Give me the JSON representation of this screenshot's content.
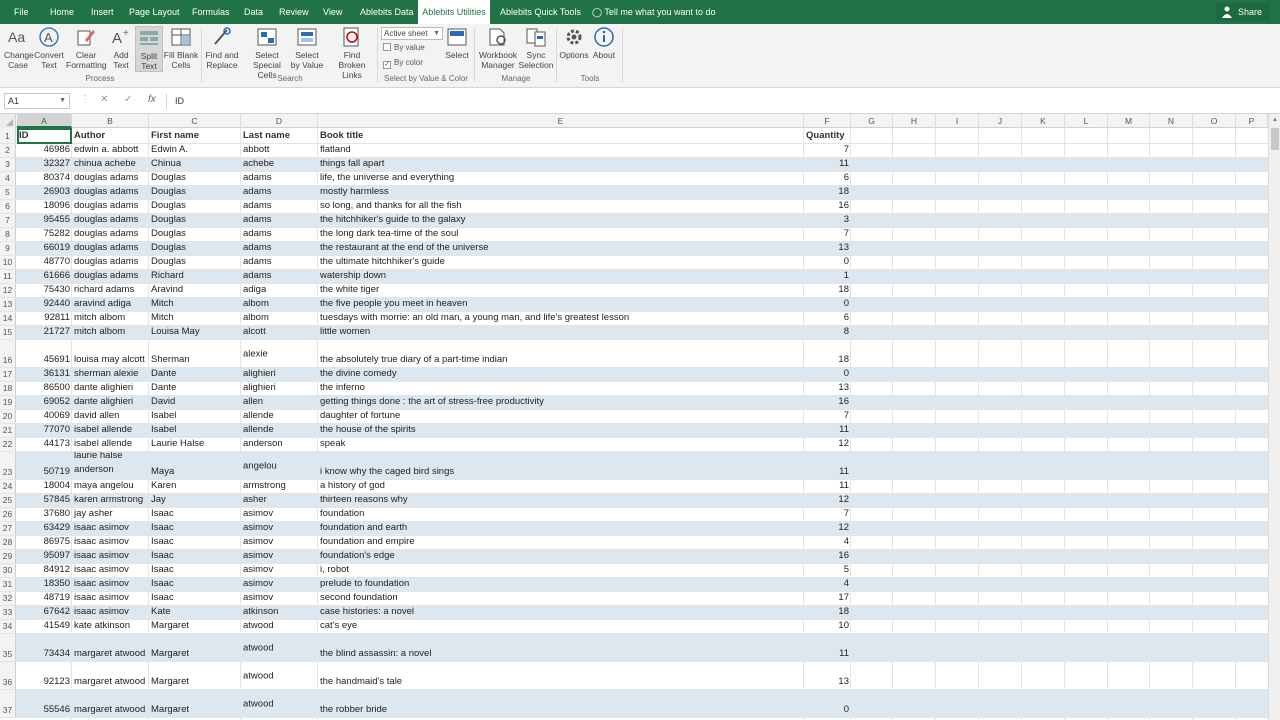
{
  "ribbon_tabs": [
    {
      "label": "File"
    },
    {
      "label": "Home"
    },
    {
      "label": "Insert"
    },
    {
      "label": "Page Layout"
    },
    {
      "label": "Formulas"
    },
    {
      "label": "Data"
    },
    {
      "label": "Review"
    },
    {
      "label": "View"
    },
    {
      "label": "Ablebits Data"
    },
    {
      "label": "Ablebits Utilities"
    },
    {
      "label": "Ablebits Quick Tools"
    }
  ],
  "active_tab": "Ablebits Utilities",
  "tell_me": "Tell me what you want to do",
  "share": "Share",
  "ribbon": {
    "buttons": [
      {
        "l1": "Change",
        "l2": "Case",
        "icon": "change-case-icon"
      },
      {
        "l1": "Convert",
        "l2": "Text",
        "icon": "convert-text-icon"
      },
      {
        "l1": "Clear",
        "l2": "Formatting",
        "icon": "clear-formatting-icon"
      },
      {
        "l1": "Add",
        "l2": "Text",
        "icon": "add-text-icon"
      },
      {
        "l1": "Split",
        "l2": "Text",
        "icon": "split-text-icon"
      },
      {
        "l1": "Fill Blank",
        "l2": "Cells",
        "icon": "fill-blank-icon"
      },
      {
        "l1": "Find and",
        "l2": "Replace",
        "icon": "find-replace-icon"
      },
      {
        "l1": "Select",
        "l2": "Special Cells",
        "icon": "select-special-icon"
      },
      {
        "l1": "Select",
        "l2": "by Value",
        "icon": "select-by-value-icon"
      },
      {
        "l1": "Find Broken",
        "l2": "Links",
        "icon": "broken-links-icon"
      },
      {
        "l1": "Select",
        "l2": "",
        "icon": "select-icon"
      },
      {
        "l1": "Workbook",
        "l2": "Manager",
        "icon": "workbook-manager-icon"
      },
      {
        "l1": "Sync",
        "l2": "Selection",
        "icon": "sync-selection-icon"
      },
      {
        "l1": "Options",
        "l2": "",
        "icon": "gear-icon"
      },
      {
        "l1": "About",
        "l2": "",
        "icon": "info-icon"
      }
    ],
    "groups": {
      "process": "Process",
      "search": "Search",
      "select": "Select by Value & Color",
      "manage": "Manage",
      "tools": "Tools"
    },
    "scope_dropdown": "Active sheet",
    "by_value": "By value",
    "by_color": "By color"
  },
  "formula_bar": {
    "name_box": "A1",
    "cancel": "✕",
    "enter": "✓",
    "fx": "fx",
    "value": "ID"
  },
  "columns": [
    "A",
    "B",
    "C",
    "D",
    "E",
    "F",
    "G",
    "H",
    "I",
    "J",
    "K",
    "L",
    "M",
    "N",
    "O",
    "P"
  ],
  "headers": [
    "ID",
    "Author",
    "First name",
    "Last name",
    "Book title",
    "Quantity"
  ],
  "rows": [
    {
      "n": "2",
      "id": "46986",
      "author": "edwin a. abbott",
      "first": "Edwin A.",
      "last": "abbott",
      "title": "flatland",
      "qty": "7"
    },
    {
      "n": "3",
      "id": "32327",
      "author": "chinua achebe",
      "first": "Chinua",
      "last": "achebe",
      "title": "things fall apart",
      "qty": "11"
    },
    {
      "n": "4",
      "id": "80374",
      "author": "douglas adams",
      "first": "Douglas",
      "last": "adams",
      "title": "life, the universe and everything",
      "qty": "6"
    },
    {
      "n": "5",
      "id": "26903",
      "author": "douglas adams",
      "first": "Douglas",
      "last": "adams",
      "title": "mostly harmless",
      "qty": "18"
    },
    {
      "n": "6",
      "id": "18096",
      "author": "douglas adams",
      "first": "Douglas",
      "last": "adams",
      "title": "so long, and thanks for all the fish",
      "qty": "16"
    },
    {
      "n": "7",
      "id": "95455",
      "author": "douglas adams",
      "first": "Douglas",
      "last": "adams",
      "title": "the hitchhiker's guide to the galaxy",
      "qty": "3"
    },
    {
      "n": "8",
      "id": "75282",
      "author": "douglas adams",
      "first": "Douglas",
      "last": "adams",
      "title": "the long dark tea-time of the soul",
      "qty": "7"
    },
    {
      "n": "9",
      "id": "66019",
      "author": "douglas adams",
      "first": "Douglas",
      "last": "adams",
      "title": "the restaurant at the end of the universe",
      "qty": "13"
    },
    {
      "n": "10",
      "id": "48770",
      "author": "douglas adams",
      "first": "Douglas",
      "last": "adams",
      "title": "the ultimate hitchhiker's guide",
      "qty": "0"
    },
    {
      "n": "11",
      "id": "61666",
      "author": "douglas adams",
      "first": "Richard",
      "last": "adams",
      "title": "watership down",
      "qty": "1"
    },
    {
      "n": "12",
      "id": "75430",
      "author": "richard adams",
      "first": "Aravind",
      "last": "adiga",
      "title": "the white tiger",
      "qty": "18"
    },
    {
      "n": "13",
      "id": "92440",
      "author": "aravind adiga",
      "first": "Mitch",
      "last": "albom",
      "title": "the five people you meet in heaven",
      "qty": "0"
    },
    {
      "n": "14",
      "id": "92811",
      "author": "mitch albom",
      "first": "Mitch",
      "last": "albom",
      "title": "tuesdays with morrie: an old man, a young man, and life's greatest lesson",
      "qty": "6"
    },
    {
      "n": "15",
      "id": "21727",
      "author": "mitch albom",
      "first": "Louisa May",
      "last": "alcott",
      "title": "little women",
      "qty": "8"
    },
    {
      "n": "16",
      "id": "45691",
      "author": "louisa may alcott",
      "first": "Sherman",
      "last": "alexie",
      "title": "the absolutely true diary of a part-time indian",
      "qty": "18",
      "tall": true
    },
    {
      "n": "17",
      "id": "36131",
      "author": "sherman alexie",
      "first": "Dante",
      "last": "alighieri",
      "title": "the divine comedy",
      "qty": "0"
    },
    {
      "n": "18",
      "id": "86500",
      "author": "dante alighieri",
      "first": "Dante",
      "last": "alighieri",
      "title": "the inferno",
      "qty": "13"
    },
    {
      "n": "19",
      "id": "69052",
      "author": "dante alighieri",
      "first": "David",
      "last": "allen",
      "title": "getting things done : the art of stress-free productivity",
      "qty": "16"
    },
    {
      "n": "20",
      "id": "40069",
      "author": "david allen",
      "first": "Isabel",
      "last": "allende",
      "title": "daughter of fortune",
      "qty": "7"
    },
    {
      "n": "21",
      "id": "77070",
      "author": "isabel allende",
      "first": "Isabel",
      "last": "allende",
      "title": "the house of the spirits",
      "qty": "11"
    },
    {
      "n": "22",
      "id": "44173",
      "author": "isabel allende",
      "first": "Laurie Halse",
      "last": "anderson",
      "title": "speak",
      "qty": "12"
    },
    {
      "n": "23",
      "id": "50719",
      "author": "laurie halse anderson",
      "first": "Maya",
      "last": "angelou",
      "title": "i know why the caged bird sings",
      "qty": "11",
      "tall": true,
      "wrap_author": true
    },
    {
      "n": "24",
      "id": "18004",
      "author": "maya angelou",
      "first": "Karen",
      "last": "armstrong",
      "title": "a history of god",
      "qty": "11"
    },
    {
      "n": "25",
      "id": "57845",
      "author": "karen armstrong",
      "first": "Jay",
      "last": "asher",
      "title": "thirteen reasons why",
      "qty": "12"
    },
    {
      "n": "26",
      "id": "37680",
      "author": "jay asher",
      "first": "Isaac",
      "last": "asimov",
      "title": "foundation",
      "qty": "7"
    },
    {
      "n": "27",
      "id": "63429",
      "author": "isaac asimov",
      "first": "Isaac",
      "last": "asimov",
      "title": "foundation and earth",
      "qty": "12"
    },
    {
      "n": "28",
      "id": "86975",
      "author": "isaac asimov",
      "first": "Isaac",
      "last": "asimov",
      "title": "foundation and empire",
      "qty": "4"
    },
    {
      "n": "29",
      "id": "95097",
      "author": "isaac asimov",
      "first": "Isaac",
      "last": "asimov",
      "title": "foundation's edge",
      "qty": "16"
    },
    {
      "n": "30",
      "id": "84912",
      "author": "isaac asimov",
      "first": "Isaac",
      "last": "asimov",
      "title": "i, robot",
      "qty": "5"
    },
    {
      "n": "31",
      "id": "18350",
      "author": "isaac asimov",
      "first": "Isaac",
      "last": "asimov",
      "title": "prelude to foundation",
      "qty": "4"
    },
    {
      "n": "32",
      "id": "48719",
      "author": "isaac asimov",
      "first": "Isaac",
      "last": "asimov",
      "title": "second foundation",
      "qty": "17"
    },
    {
      "n": "33",
      "id": "67642",
      "author": "isaac asimov",
      "first": "Kate",
      "last": "atkinson",
      "title": "case histories: a novel",
      "qty": "18"
    },
    {
      "n": "34",
      "id": "41549",
      "author": "kate atkinson",
      "first": "Margaret",
      "last": "atwood",
      "title": "cat's eye",
      "qty": "10"
    },
    {
      "n": "35",
      "id": "73434",
      "author": "margaret atwood",
      "first": "Margaret",
      "last": "atwood",
      "title": "the blind assassin: a novel",
      "qty": "11",
      "tall": true
    },
    {
      "n": "36",
      "id": "92123",
      "author": "margaret atwood",
      "first": "Margaret",
      "last": "atwood",
      "title": "the handmaid's tale",
      "qty": "13",
      "tall": true
    },
    {
      "n": "37",
      "id": "55546",
      "author": "margaret atwood",
      "first": "Margaret",
      "last": "atwood",
      "title": "the robber bride",
      "qty": "0",
      "tall": true
    }
  ],
  "colors": {
    "excel_green": "#217346",
    "band_blue": "#dde7ef"
  }
}
